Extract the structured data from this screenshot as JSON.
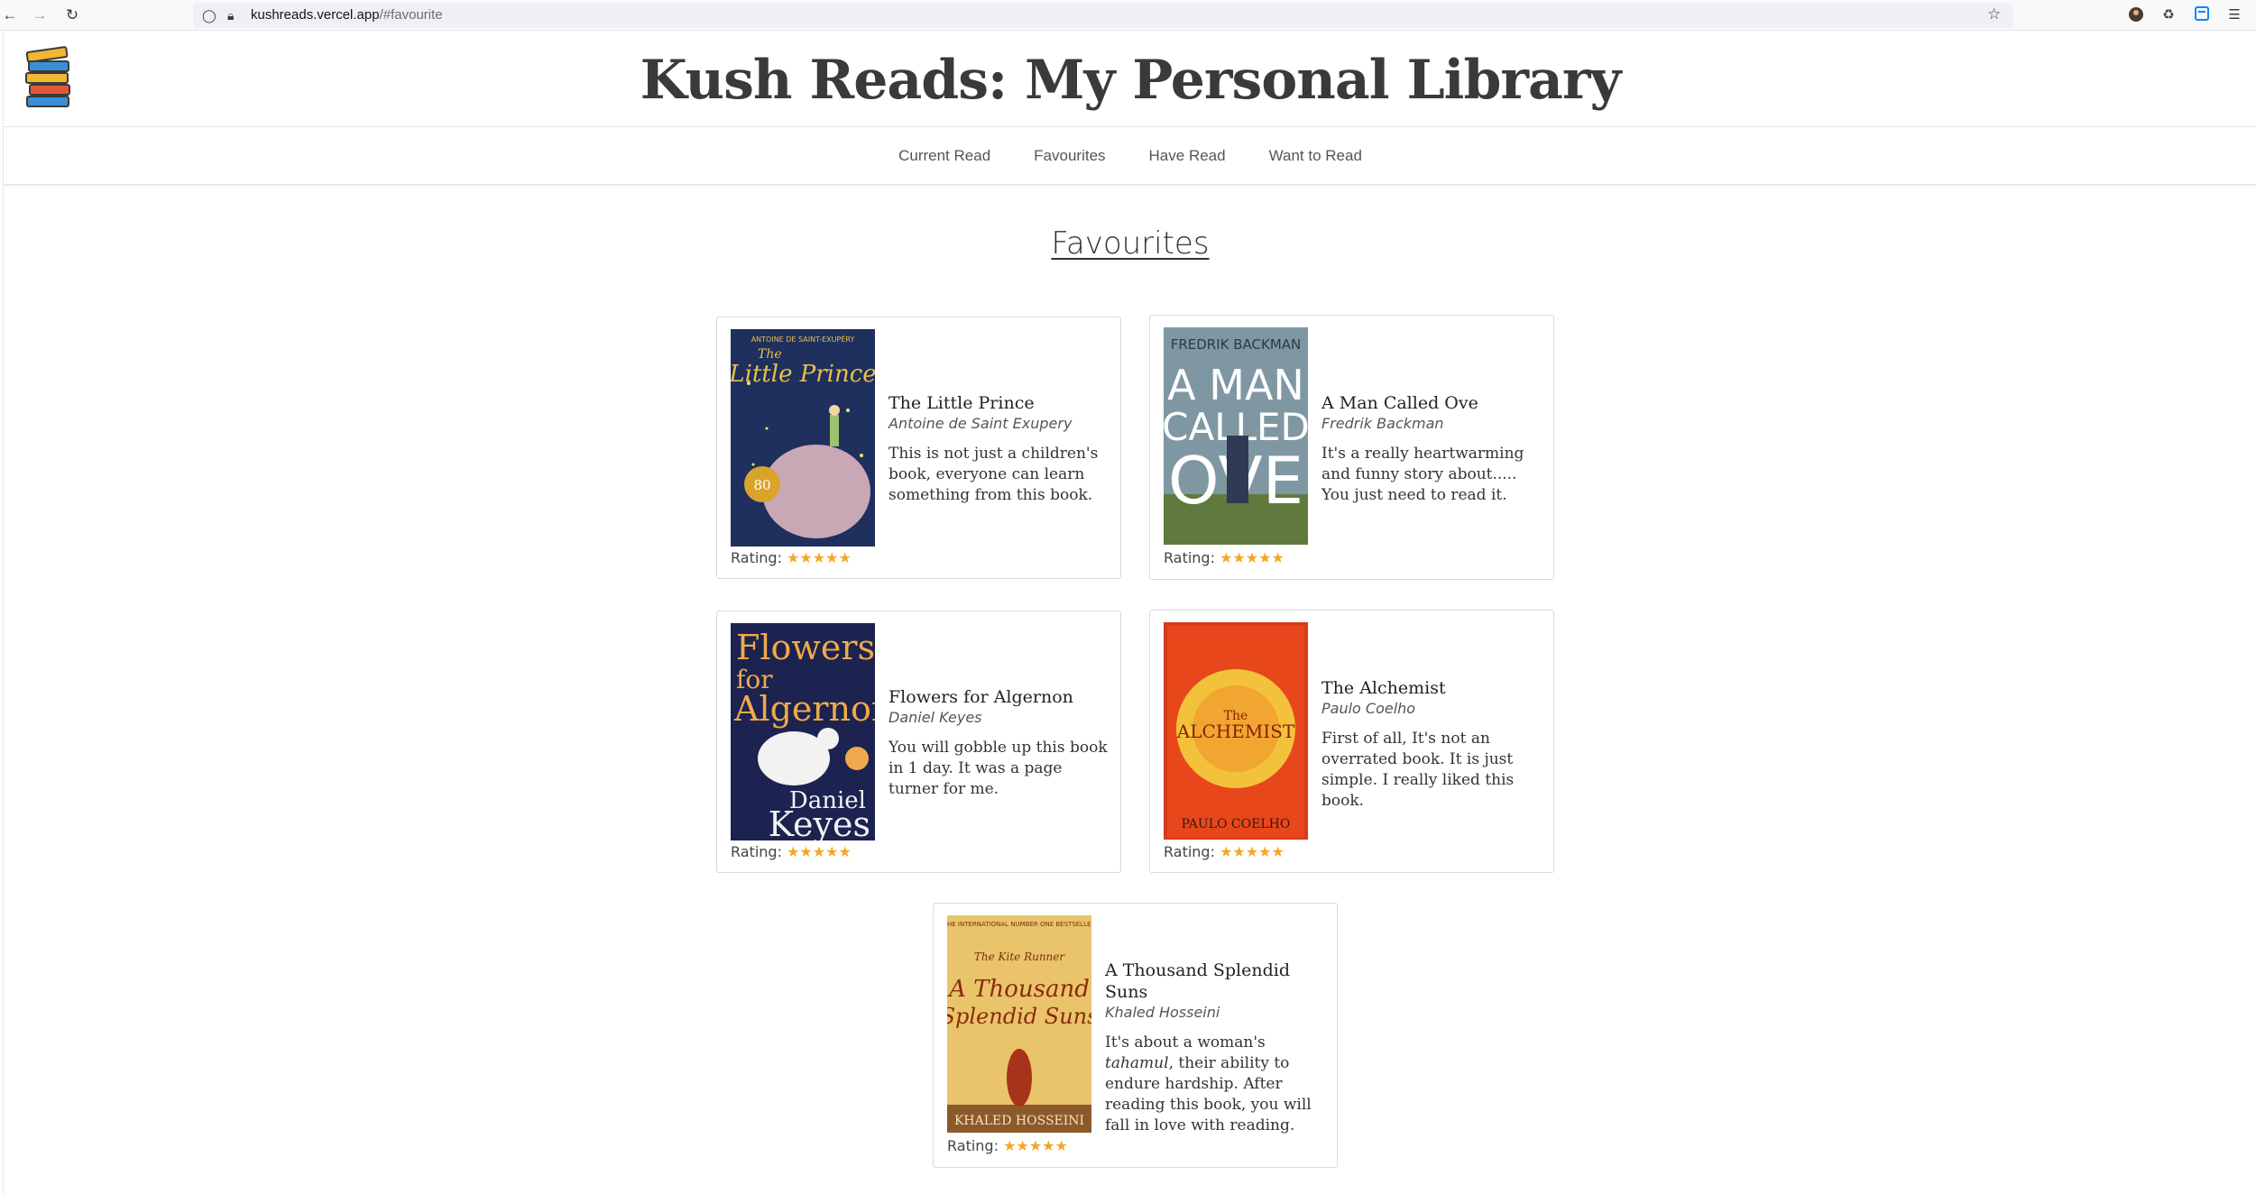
{
  "browser": {
    "url_host": "kushreads.vercel.app",
    "url_path": "/#favourite"
  },
  "site": {
    "title": "Kush Reads: My Personal Library"
  },
  "nav": {
    "items": [
      "Current Read",
      "Favourites",
      "Have Read",
      "Want to Read"
    ]
  },
  "section": {
    "title": "Favourites"
  },
  "books": [
    {
      "title": "The Little Prince",
      "author": "Antoine de Saint Exupery",
      "description": "This is not just a children's book, everyone can learn something from this book.",
      "rating_label": "Rating:",
      "rating": 5,
      "cover_colors": [
        "#1f2f5e",
        "#e8c14a"
      ]
    },
    {
      "title": "A Man Called Ove",
      "author": "Fredrik Backman",
      "description": "It's a really heartwarming and funny story about..... You just need to read it.",
      "rating_label": "Rating:",
      "rating": 5,
      "cover_colors": [
        "#7f97a3",
        "#5f7a3c"
      ]
    },
    {
      "title": "Flowers for Algernon",
      "author": "Daniel Keyes",
      "description": "You will gobble up this book in 1 day. It was a page turner for me.",
      "rating_label": "Rating:",
      "rating": 5,
      "cover_colors": [
        "#1c2350",
        "#f0a94a"
      ]
    },
    {
      "title": "The Alchemist",
      "author": "Paulo Coelho",
      "description": "First of all, It's not an overrated book. It is just simple. I really liked this book.",
      "rating_label": "Rating:",
      "rating": 5,
      "cover_colors": [
        "#e8471c",
        "#f3c23b"
      ]
    },
    {
      "title": "A Thousand Splendid Suns",
      "author": "Khaled Hosseini",
      "description_before": "It's about a woman's ",
      "description_em": "tahamul",
      "description_after": ", their ability to endure hardship. After reading this book, you will fall in love with reading.",
      "rating_label": "Rating:",
      "rating": 5,
      "cover_colors": [
        "#e9c46a",
        "#8b3a1e"
      ]
    }
  ],
  "theme": {
    "star_color": "#f5a623",
    "card_border": "#d9d9d9"
  }
}
